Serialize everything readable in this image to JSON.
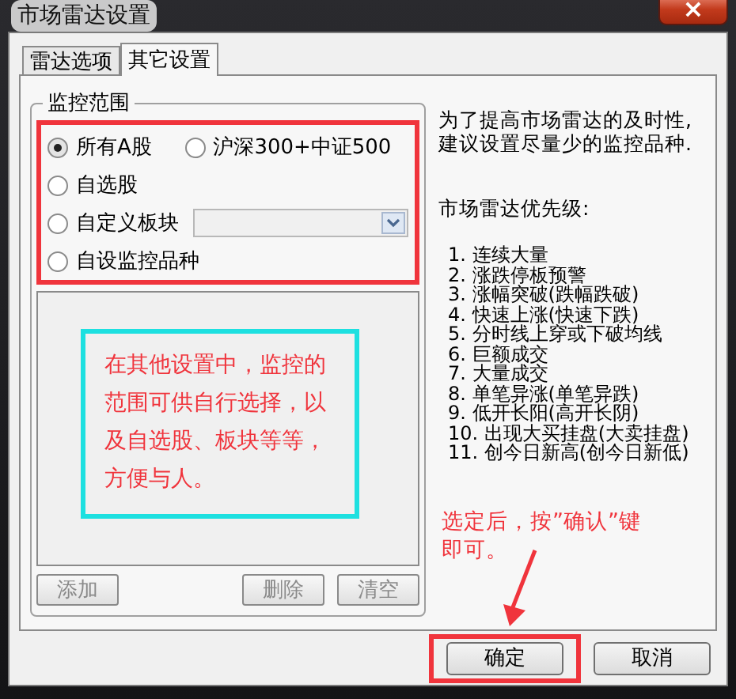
{
  "window": {
    "title": "市场雷达设置",
    "close": "×"
  },
  "tabs": [
    {
      "label": "雷达选项",
      "selected": false
    },
    {
      "label": "其它设置",
      "selected": true
    }
  ],
  "monitor_scope": {
    "title": "监控范围",
    "options": [
      {
        "label": "所有A股",
        "selected": true,
        "kind": "plain"
      },
      {
        "label": "沪深300+中证500",
        "selected": false,
        "kind": "plain"
      },
      {
        "label": "自选股",
        "selected": false,
        "kind": "plain"
      },
      {
        "label": "自定义板块",
        "selected": false,
        "kind": "dropdown"
      },
      {
        "label": "自设监控品种",
        "selected": false,
        "kind": "plain"
      }
    ],
    "list_buttons": [
      {
        "label": "添加",
        "disabled": true
      },
      {
        "label": "删除",
        "disabled": true
      },
      {
        "label": "清空",
        "disabled": true
      }
    ]
  },
  "info": {
    "note": "为了提高市场雷达的及时性,建议设置尽量少的监控品种.",
    "priority_title": "市场雷达优先级:",
    "priority_items": [
      "1. 连续大量",
      "2. 涨跌停板预警",
      "3. 涨幅突破(跌幅跌破)",
      "4. 快速上涨(快速下跌)",
      "5. 分时线上穿或下破均线",
      "6. 巨额成交",
      "7. 大量成交",
      "8. 单笔异涨(单笔异跌)",
      "9. 低开长阳(高开长阴)",
      "10. 出现大买挂盘(大卖挂盘)",
      "11. 创今日新高(创今日新低)"
    ]
  },
  "annotations": [
    {
      "kind": "callout-box",
      "text": "在其他设置中，监控的范围可供自行选择，以及自选股、板块等等，方便与人。"
    },
    {
      "kind": "arrow-note",
      "text": "选定后，按”确认”键即可。"
    }
  ],
  "buttons": [
    {
      "label": "确定"
    },
    {
      "label": "取消"
    }
  ]
}
